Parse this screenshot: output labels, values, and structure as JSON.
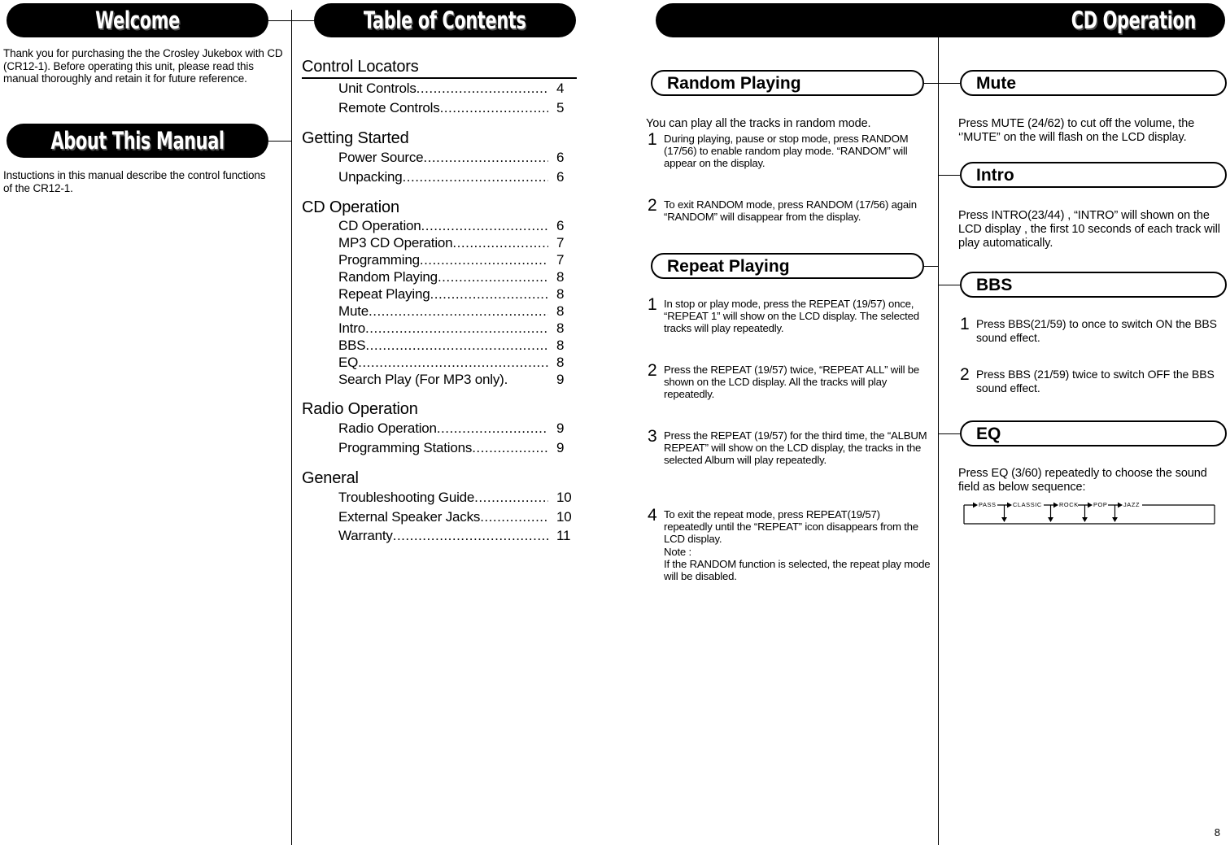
{
  "page": {
    "number": "8"
  },
  "left_column": {
    "welcome": {
      "banner": "Welcome",
      "body": "Thank you for purchasing the the Crosley Jukebox with CD (CR12-1).  Before operating this unit, please read this manual thoroughly and retain it for future reference."
    },
    "about": {
      "banner": "About This Manual",
      "body": "Instuctions in this manual describe the control functions of the CR12-1."
    }
  },
  "toc": {
    "banner": "Table of Contents",
    "groups": [
      {
        "heading": "Control Locators",
        "ruled": true,
        "entries": [
          {
            "label": "Unit Controls",
            "page": "4"
          },
          {
            "label": "Remote Controls",
            "page": "5"
          }
        ]
      },
      {
        "heading": "Getting Started",
        "ruled": false,
        "entries": [
          {
            "label": "Power Source",
            "page": "6"
          },
          {
            "label": "Unpacking",
            "page": "6"
          }
        ]
      },
      {
        "heading": "CD Operation",
        "ruled": false,
        "entries": [
          {
            "label": "CD Operation",
            "page": "6"
          },
          {
            "label": "MP3 CD Operation",
            "page": "7"
          },
          {
            "label": "Programming",
            "page": "7"
          },
          {
            "label": "Random Playing",
            "page": "8"
          },
          {
            "label": "Repeat Playing",
            "page": "8"
          },
          {
            "label": "Mute",
            "page": "8"
          },
          {
            "label": "Intro",
            "page": "8"
          },
          {
            "label": "BBS",
            "page": "8"
          },
          {
            "label": "EQ",
            "page": "8"
          },
          {
            "label": "Search Play (For MP3 only).",
            "page": "9",
            "nodots": true
          }
        ]
      },
      {
        "heading": "Radio Operation",
        "ruled": false,
        "entries": [
          {
            "label": "Radio Operation",
            "page": "9"
          },
          {
            "label": "Programming Stations",
            "page": "9"
          }
        ]
      },
      {
        "heading": "General",
        "ruled": false,
        "entries": [
          {
            "label": "Troubleshooting Guide",
            "page": "10"
          },
          {
            "label": "External Speaker Jacks",
            "page": "10"
          },
          {
            "label": "Warranty",
            "page": "11"
          }
        ]
      }
    ]
  },
  "right_page": {
    "banner": "CD Operation",
    "random_playing": {
      "title": "Random Playing",
      "intro": "You can play all the tracks in random mode.",
      "steps": [
        {
          "num": "1",
          "text": "During playing, pause or stop mode, press RANDOM (17/56) to enable random play mode. “RANDOM” will appear on the display."
        },
        {
          "num": "2",
          "text": "To exit RANDOM mode, press RANDOM (17/56) again “RANDOM” will disappear from the display."
        }
      ]
    },
    "repeat_playing": {
      "title": "Repeat Playing",
      "steps": [
        {
          "num": "1",
          "text": "In stop or play mode, press the REPEAT (19/57) once, “REPEAT 1” will show on the LCD display. The selected tracks will play repeatedly."
        },
        {
          "num": "2",
          "text": "Press the REPEAT (19/57) twice, “REPEAT ALL” will be shown on the LCD display. All the tracks will play repeatedly."
        },
        {
          "num": "3",
          "text": "Press the REPEAT (19/57) for the third time, the “ALBUM REPEAT” will show on the LCD display, the tracks in the selected Album will play repeatedly."
        },
        {
          "num": "4",
          "text": "To exit the repeat mode, press REPEAT(19/57) repeatedly until the “REPEAT” icon disappears from the LCD display.\nNote :\nIf the RANDOM function is selected, the repeat play mode will be disabled."
        }
      ]
    },
    "mute": {
      "title": "Mute",
      "body": "Press MUTE (24/62) to cut off the volume, the ‘’MUTE” on the will flash on the LCD display."
    },
    "intro": {
      "title": "Intro",
      "body": "Press INTRO(23/44) , “INTRO” will shown on the LCD display , the first 10 seconds of each track will play automatically."
    },
    "bbs": {
      "title": "BBS",
      "steps": [
        {
          "num": "1",
          "text": "Press BBS(21/59) to once to switch ON the BBS sound effect."
        },
        {
          "num": "2",
          "text": "Press BBS (21/59) twice to switch OFF the BBS sound effect."
        }
      ]
    },
    "eq": {
      "title": "EQ",
      "body": "Press EQ (3/60) repeatedly to choose the sound field as below sequence:",
      "sequence": [
        "PASS",
        "CLASSIC",
        "ROCK",
        "POP",
        "JAZZ"
      ]
    }
  }
}
